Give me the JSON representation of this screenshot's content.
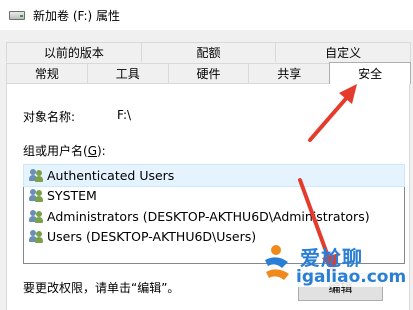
{
  "window": {
    "title": "新加卷 (F:) 属性"
  },
  "tabs": {
    "upper": [
      {
        "label": "以前的版本"
      },
      {
        "label": "配额"
      },
      {
        "label": "自定义"
      }
    ],
    "lower": [
      {
        "label": "常规"
      },
      {
        "label": "工具"
      },
      {
        "label": "硬件"
      },
      {
        "label": "共享"
      },
      {
        "label": "安全",
        "selected": true
      }
    ]
  },
  "security": {
    "object_name_label": "对象名称:",
    "object_name_value": "F:\\",
    "group_label": "组或用户名(",
    "group_label_key": "G",
    "group_label_suffix": "):",
    "users": [
      {
        "name": "Authenticated Users",
        "icon": "user-group-icon",
        "selected": true
      },
      {
        "name": "SYSTEM",
        "icon": "user-group-icon"
      },
      {
        "name": "Administrators (DESKTOP-AKTHU6D\\Administrators)",
        "icon": "user-group-icon"
      },
      {
        "name": "Users (DESKTOP-AKTHU6D\\Users)",
        "icon": "user-group-icon"
      }
    ],
    "hint": "要更改权限，请单击“编辑”。",
    "edit_button": "编辑"
  },
  "watermark": {
    "title": "爱尬聊",
    "url": "igaliao.com"
  },
  "colors": {
    "arrow": "#e53b2c",
    "selection": "#e5f3ff",
    "watermark": "#2a7fd4",
    "watermark_accent": "#f08a1c"
  }
}
